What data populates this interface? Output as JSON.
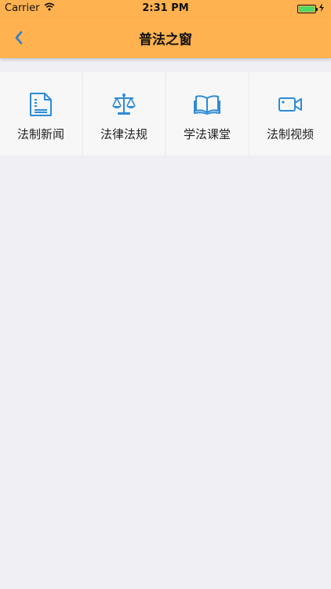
{
  "status": {
    "carrier": "Carrier",
    "time": "2:31 PM"
  },
  "nav": {
    "title": "普法之窗"
  },
  "menu": {
    "items": [
      {
        "label": "法制新闻",
        "icon": "document-icon"
      },
      {
        "label": "法律法规",
        "icon": "scales-icon"
      },
      {
        "label": "学法课堂",
        "icon": "open-book-icon"
      },
      {
        "label": "法制视频",
        "icon": "video-camera-icon"
      }
    ]
  },
  "colors": {
    "accent": "#FFB24F",
    "icon": "#2D8BD6",
    "background": "#EFEFF4"
  }
}
